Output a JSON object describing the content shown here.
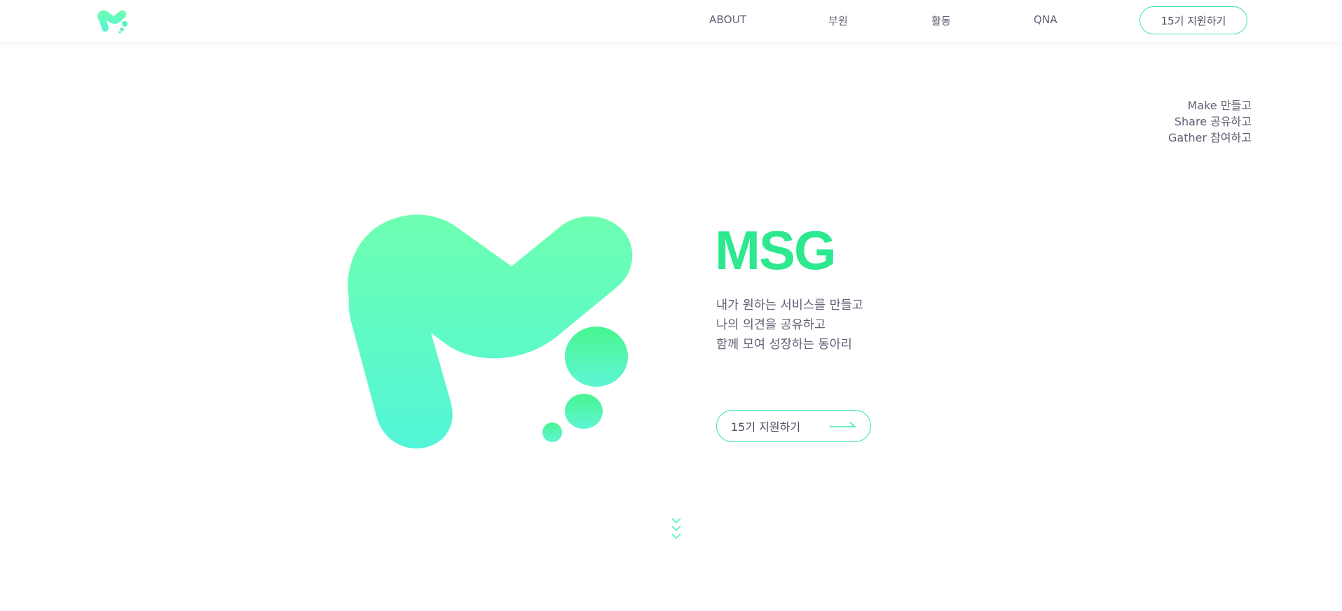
{
  "brand": {
    "name": "MSG",
    "accent": "#2ee88f",
    "gradient_top": "#6effb0",
    "gradient_bottom": "#52f5d8"
  },
  "nav": {
    "items": [
      {
        "label": "ABOUT"
      },
      {
        "label": "부원"
      },
      {
        "label": "활동"
      },
      {
        "label": "QNA"
      }
    ],
    "apply_label": "15기 지원하기"
  },
  "tagline": {
    "lines": [
      "Make 만들고",
      "Share 공유하고",
      "Gather 참여하고"
    ]
  },
  "hero": {
    "title": "MSG",
    "description": [
      "내가 원하는 서비스를 만들고",
      "나의 의견을 공유하고",
      "함께 모여 성장하는 동아리"
    ],
    "apply_label": "15기 지원하기",
    "arrow_icon": "long-arrow-right-icon"
  },
  "scroll": {
    "icon": "triple-chevron-down-icon"
  }
}
